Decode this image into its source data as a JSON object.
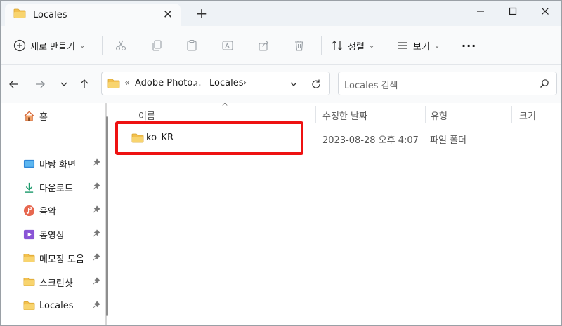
{
  "window": {
    "tab_title": "Locales",
    "tab_close": "✕",
    "new_tab": "+"
  },
  "toolbar": {
    "new_label": "새로 만들기",
    "sort_label": "정렬",
    "view_label": "보기",
    "more_label": "···"
  },
  "address": {
    "overflow": "«",
    "path": [
      "Adobe Photo...",
      "Locales"
    ],
    "separator": "›"
  },
  "search": {
    "placeholder": "Locales 검색"
  },
  "sidebar": {
    "items": [
      {
        "label": "홈",
        "icon": "home-icon"
      },
      {
        "label": "바탕 화면",
        "icon": "desktop-icon"
      },
      {
        "label": "다운로드",
        "icon": "download-icon"
      },
      {
        "label": "음악",
        "icon": "music-icon"
      },
      {
        "label": "동영상",
        "icon": "video-icon"
      },
      {
        "label": "메모장 모음",
        "icon": "folder-icon"
      },
      {
        "label": "스크린샷",
        "icon": "folder-icon"
      },
      {
        "label": "Locales",
        "icon": "folder-icon"
      }
    ]
  },
  "columns": {
    "name": "이름",
    "date": "수정한 날짜",
    "type": "유형",
    "size": "크기"
  },
  "files": [
    {
      "name": "ko_KR",
      "date": "2023-08-28 오후 4:07",
      "type": "파일 폴더"
    }
  ],
  "colors": {
    "folder": "#f3c04e",
    "highlight": "#ee1111",
    "accent": "#0a64c8"
  }
}
